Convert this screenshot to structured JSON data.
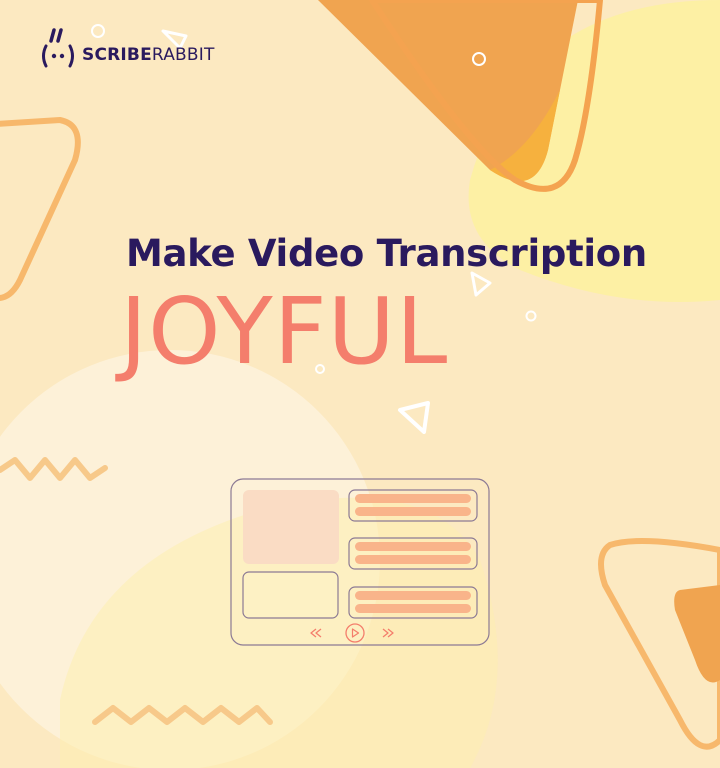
{
  "brand": {
    "name_part1": "SCRIBE",
    "name_part2": "RABBIT"
  },
  "headline": "Make Video Transcription",
  "accent_word": "JOYFUL",
  "colors": {
    "background": "#fce9c1",
    "headline": "#2a1a5e",
    "accent": "#f47e6c",
    "orange": "#f0a450",
    "outline": "#f7b86c"
  },
  "icons": {
    "rewind": "rewind-icon",
    "play": "play-icon",
    "fast_forward": "fast-forward-icon"
  }
}
